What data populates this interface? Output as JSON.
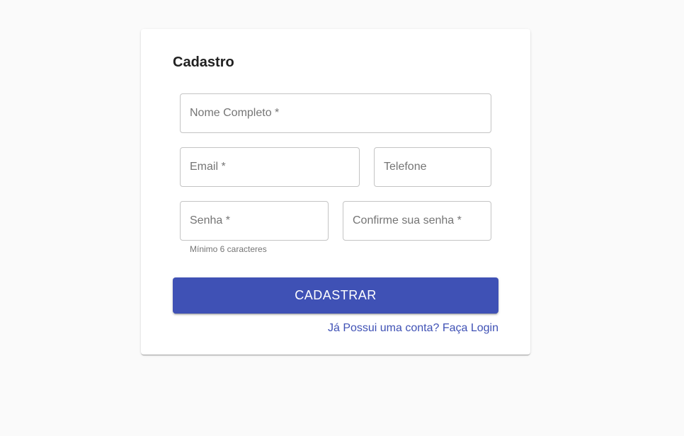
{
  "form": {
    "title": "Cadastro",
    "fields": {
      "nome": "Nome Completo *",
      "email": "Email *",
      "telefone": "Telefone",
      "senha": "Senha *",
      "confirme": "Confirme sua senha *"
    },
    "senha_helper": "Mínimo 6 caracteres",
    "submit_label": "CADASTRAR",
    "login_link": "Já Possui uma conta? Faça Login"
  },
  "colors": {
    "primary": "#3f51b5",
    "background": "#fafafa",
    "card": "#ffffff",
    "border": "#c4c4c4",
    "label": "#757575"
  }
}
